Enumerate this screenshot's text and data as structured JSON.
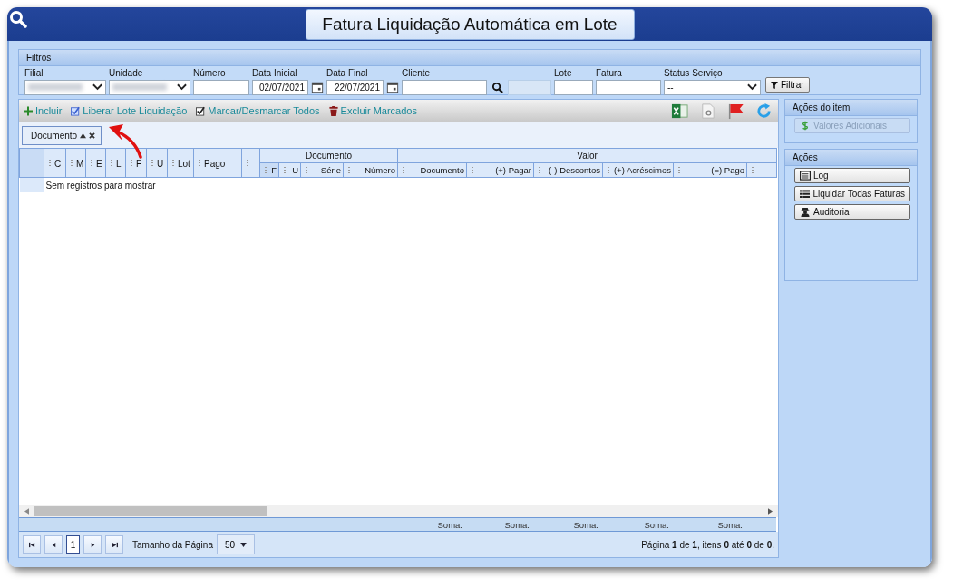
{
  "window": {
    "title": "Fatura Liquidação Automática em Lote"
  },
  "filters": {
    "title": "Filtros",
    "button": "Filtrar",
    "fields": [
      {
        "label": "Filial",
        "kind": "select",
        "blurred": true
      },
      {
        "label": "Unidade",
        "kind": "select",
        "blurred": true
      },
      {
        "label": "Número",
        "kind": "text"
      },
      {
        "label": "Data Inicial",
        "kind": "date",
        "value": "02/07/2021"
      },
      {
        "label": "Data Final",
        "kind": "date",
        "value": "22/07/2021"
      },
      {
        "label": "Cliente",
        "kind": "lookup"
      },
      {
        "label": "Lote",
        "kind": "text"
      },
      {
        "label": "Fatura",
        "kind": "text"
      },
      {
        "label": "Status Serviço",
        "kind": "select",
        "blurred": false,
        "value": "--"
      }
    ]
  },
  "toolbar": {
    "actions": [
      {
        "label": "Incluir",
        "kind": "plus"
      },
      {
        "label": "Liberar Lote Liquidação",
        "kind": "check"
      },
      {
        "label": "Marcar/Desmarcar Todos",
        "kind": "checkbox"
      },
      {
        "label": "Excluir Marcados",
        "kind": "trash"
      }
    ]
  },
  "group_panel": {
    "chips": [
      {
        "label": "Documento"
      }
    ]
  },
  "grid": {
    "columns": [
      {
        "kind": "column",
        "label": "C"
      },
      {
        "kind": "column",
        "label": "M"
      },
      {
        "kind": "column",
        "label": "E"
      },
      {
        "kind": "column",
        "label": "L"
      },
      {
        "kind": "column",
        "label": "F"
      },
      {
        "kind": "column",
        "label": "U"
      },
      {
        "kind": "column",
        "label": "Lot"
      },
      {
        "kind": "column",
        "label": "Pago"
      },
      {
        "kind": "column"
      },
      {
        "kind": "group",
        "label": "Documento",
        "columns": [
          {
            "label": "F"
          },
          {
            "label": "U"
          },
          {
            "label": "Série"
          },
          {
            "label": "Número"
          }
        ]
      },
      {
        "kind": "group",
        "label": "Valor",
        "columns": [
          {
            "label": "Documento"
          },
          {
            "label": "(+) Pagar"
          },
          {
            "label": "(-) Descontos"
          },
          {
            "label": "(+) Acréscimos"
          },
          {
            "label": "(=) Pago"
          },
          {}
        ]
      }
    ],
    "empty_message": "Sem registros para mostrar",
    "footer": [
      "Soma:",
      "Soma:",
      "Soma:",
      "Soma:",
      "Soma:"
    ]
  },
  "pager": {
    "pages": [
      {
        "label": "1",
        "selected": true
      }
    ],
    "page_size_label": "Tamanho da Página",
    "page_size": "50",
    "summary": "Página **1** de **1**, itens **0** até **0** de **0**."
  },
  "sidebar": {
    "panels": [
      {
        "title": "Ações do item",
        "buttons": [
          {
            "label": "Valores Adicionais",
            "kind": "dollar",
            "disabled": true
          }
        ]
      },
      {
        "title": "Ações",
        "buttons": [
          {
            "label": "Log",
            "kind": "log",
            "disabled": false
          },
          {
            "label": "Liquidar Todas Faturas",
            "kind": "list",
            "disabled": false
          },
          {
            "label": "Auditoria",
            "kind": "spy",
            "disabled": false
          }
        ]
      }
    ]
  }
}
